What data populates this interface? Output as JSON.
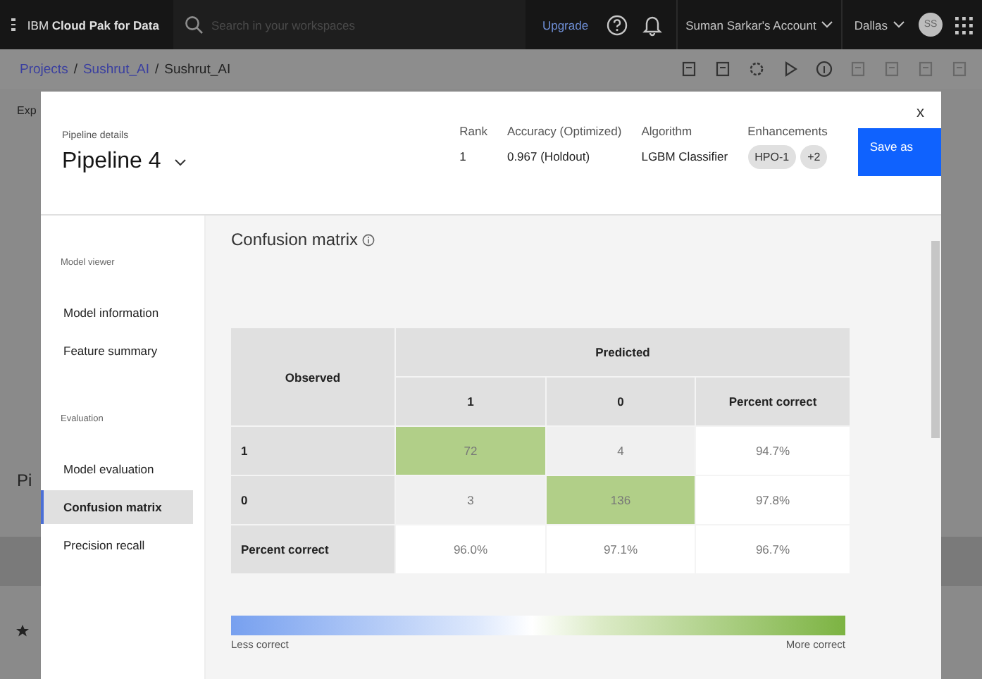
{
  "top_bar": {
    "brand_prefix": "IBM",
    "brand": "Cloud Pak for Data",
    "search": {
      "placeholder": "Search in your workspaces"
    },
    "upgrade": "Upgrade",
    "account": "Suman Sarkar's Account",
    "region": "Dallas",
    "avatar": "SS"
  },
  "breadcrumb": [
    {
      "label": "Projects",
      "link": true
    },
    {
      "label": "Sushrut_AI",
      "link": true
    },
    {
      "label": "Sushrut_AI",
      "link": false
    }
  ],
  "breadcrumb_separator": "/",
  "background": {
    "tab": "Exp",
    "heading": "Pi"
  },
  "modal": {
    "label": "Pipeline details",
    "pipeline": "Pipeline 4",
    "stats": [
      {
        "label": "Rank",
        "value": "1"
      },
      {
        "label": "Accuracy  (Optimized)",
        "value": "0.967 (Holdout)"
      },
      {
        "label": "Algorithm",
        "value": "LGBM Classifier"
      }
    ],
    "enhancements": {
      "label": "Enhancements",
      "tags": [
        "HPO-1",
        "+2"
      ]
    },
    "save_button": "Save as",
    "close": "x"
  },
  "nav": [
    {
      "title": "Model viewer",
      "items": [
        {
          "label": "Model information",
          "selected": false
        },
        {
          "label": "Feature summary",
          "selected": false
        }
      ]
    },
    {
      "title": "Evaluation",
      "items": [
        {
          "label": "Model evaluation",
          "selected": false
        },
        {
          "label": "Confusion matrix",
          "selected": true
        },
        {
          "label": "Precision recall",
          "selected": false
        }
      ]
    }
  ],
  "matrix": {
    "title": "Confusion matrix",
    "observed": "Observed",
    "predicted": "Predicted",
    "columns": [
      "1",
      "0",
      "Percent correct"
    ],
    "rows": [
      {
        "label": "1",
        "cells": [
          {
            "value": "72",
            "kind": "correct"
          },
          {
            "value": "4",
            "kind": "incorrect"
          },
          {
            "value": "94.7%",
            "kind": "percent"
          }
        ]
      },
      {
        "label": "0",
        "cells": [
          {
            "value": "3",
            "kind": "incorrect"
          },
          {
            "value": "136",
            "kind": "correct"
          },
          {
            "value": "97.8%",
            "kind": "percent"
          }
        ]
      },
      {
        "label": "Percent correct",
        "cells": [
          {
            "value": "96.0%",
            "kind": "percent"
          },
          {
            "value": "97.1%",
            "kind": "percent"
          },
          {
            "value": "96.7%",
            "kind": "percent"
          }
        ]
      }
    ],
    "legend": {
      "low": "Less correct",
      "high": "More correct"
    }
  }
}
